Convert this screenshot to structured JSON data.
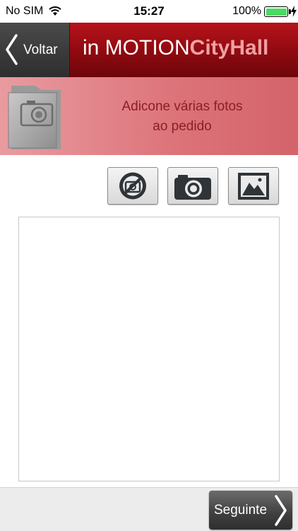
{
  "status_bar": {
    "carrier": "No SIM",
    "time": "15:27",
    "battery_percent": "100%",
    "battery_level": 1.0,
    "battery_color": "#4cd964",
    "icons": [
      "wifi-icon",
      "battery-icon",
      "charging-bolt-icon"
    ]
  },
  "header": {
    "back_label": "Voltar",
    "back_icon": "chevron-left-icon",
    "title_regular": "in MOTION",
    "title_bold": "CityHall",
    "colors": {
      "bar": "#a00f16",
      "back_button": "#3c3c3c",
      "title_bold": "#f1a0a4"
    }
  },
  "banner": {
    "icon": "photo-folder-icon",
    "line1": "Adicone várias fotos",
    "line2": "ao pedido",
    "color": "#dc7379"
  },
  "toolbar": {
    "buttons": [
      {
        "icon": "no-photo-icon"
      },
      {
        "icon": "camera-icon"
      },
      {
        "icon": "gallery-icon"
      }
    ]
  },
  "photo_area": {
    "photo_count": 0
  },
  "footer": {
    "next_label": "Seguinte",
    "next_icon": "chevron-right-icon"
  }
}
